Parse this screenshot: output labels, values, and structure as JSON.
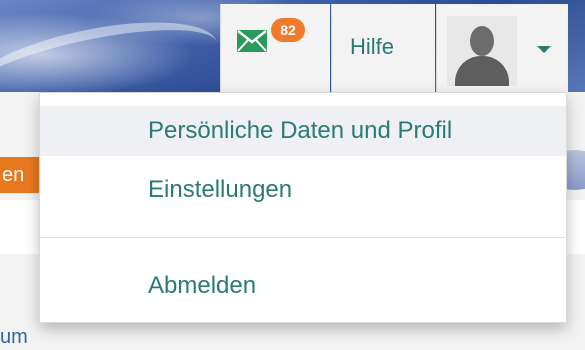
{
  "background": {
    "orange_tab_fragment": "en",
    "bottom_link_fragment": "um"
  },
  "toolbar": {
    "mail_badge_count": "82",
    "help_label": "Hilfe"
  },
  "user_menu": {
    "items": [
      {
        "label": "Persönliche Daten und Profil"
      },
      {
        "label": "Einstellungen"
      },
      {
        "label": "Abmelden"
      }
    ]
  },
  "colors": {
    "accent_teal": "#2a7b73",
    "badge_orange": "#f07a2a",
    "tab_orange": "#e8781e",
    "header_blue": "#3f5fa8"
  },
  "icons": {
    "mail": "envelope-icon",
    "avatar": "user-avatar-silhouette",
    "caret": "caret-down-icon"
  }
}
